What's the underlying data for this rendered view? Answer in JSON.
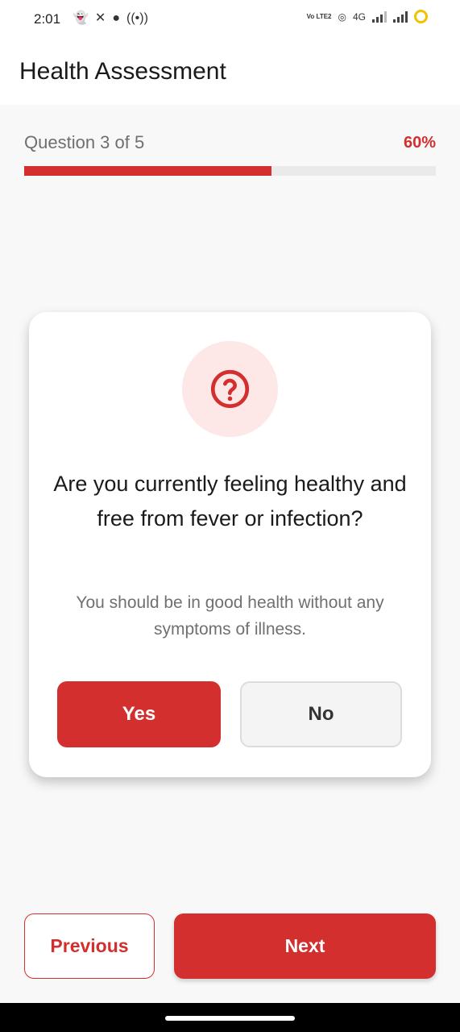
{
  "status_bar": {
    "time": "2:01",
    "left_icons": [
      "snapchat-icon",
      "x-icon",
      "whatsapp-icon",
      "hotspot-icon"
    ],
    "network_label": "4G",
    "volte_label": "Vo LTE2",
    "battery_color": "#f2c200"
  },
  "app_bar": {
    "title": "Health Assessment"
  },
  "progress": {
    "label": "Question 3 of 5",
    "percent_label": "60%",
    "fraction": 0.6,
    "accent_color": "#d32f2f"
  },
  "question_card": {
    "icon": "help-circle-icon",
    "question": "Are you currently feeling healthy and free from fever or infection?",
    "hint": "You should be in good health without any symptoms of illness.",
    "yes_label": "Yes",
    "no_label": "No",
    "selected": "Yes"
  },
  "navigation": {
    "previous_label": "Previous",
    "next_label": "Next"
  }
}
